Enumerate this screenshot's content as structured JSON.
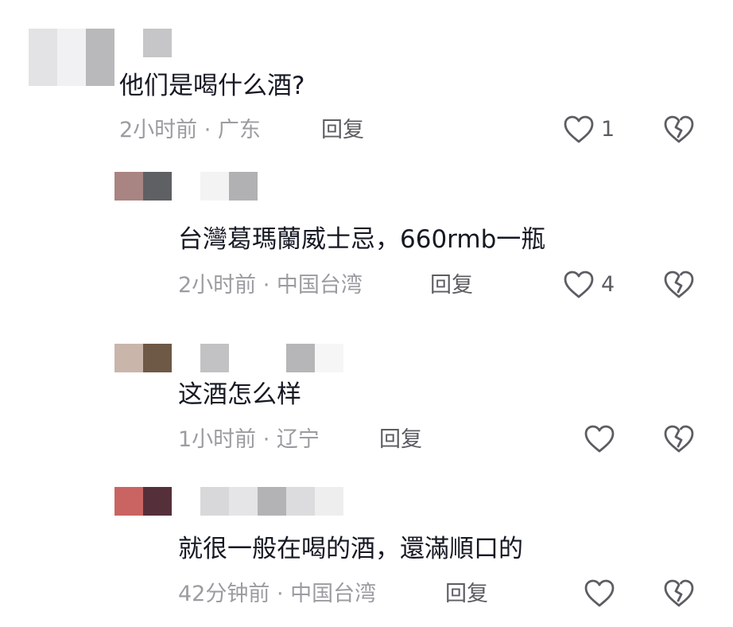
{
  "comments": [
    {
      "text": "他们是喝什么酒?",
      "meta": "2小时前 · 广东",
      "reply_label": "回复",
      "like_count": "1",
      "avatar_colors": [
        "#e3e3e5",
        "#f1f1f3",
        "#b9b9bb",
        "#ffffff",
        "#c6c6c8"
      ],
      "name_colors": [
        "#c9c9cb"
      ]
    },
    {
      "text": "台灣葛瑪蘭威士忌，660rmb一瓶",
      "meta": "2小时前 · 中国台湾",
      "reply_label": "回复",
      "like_count": "4",
      "avatar_colors": [
        "#a88482",
        "#5f6063"
      ],
      "name_colors": [
        "#f3f3f3",
        "#b1b1b3"
      ]
    },
    {
      "text": "这酒怎么样",
      "meta": "1小时前 · 辽宁",
      "reply_label": "回复",
      "like_count": "",
      "avatar_colors": [
        "#cab5ab",
        "#6e5846"
      ],
      "name_colors": [
        "#c2c2c4",
        "#b6b6b8",
        "#f6f6f6"
      ]
    },
    {
      "text": "就很一般在喝的酒，還滿順口的",
      "meta": "42分钟前 · 中国台湾",
      "reply_label": "回复",
      "like_count": "",
      "avatar_colors": [
        "#c96462",
        "#55303a"
      ],
      "name_colors": [
        "#d8d8da",
        "#e5e5e7",
        "#b3b3b5",
        "#dcdcde",
        "#eeeeee"
      ]
    }
  ],
  "icons": {
    "like": "heart-outline-icon",
    "dislike": "broken-heart-icon"
  },
  "colors": {
    "text": "#161823",
    "meta": "#9b9ca1",
    "action": "#5c5d63"
  }
}
